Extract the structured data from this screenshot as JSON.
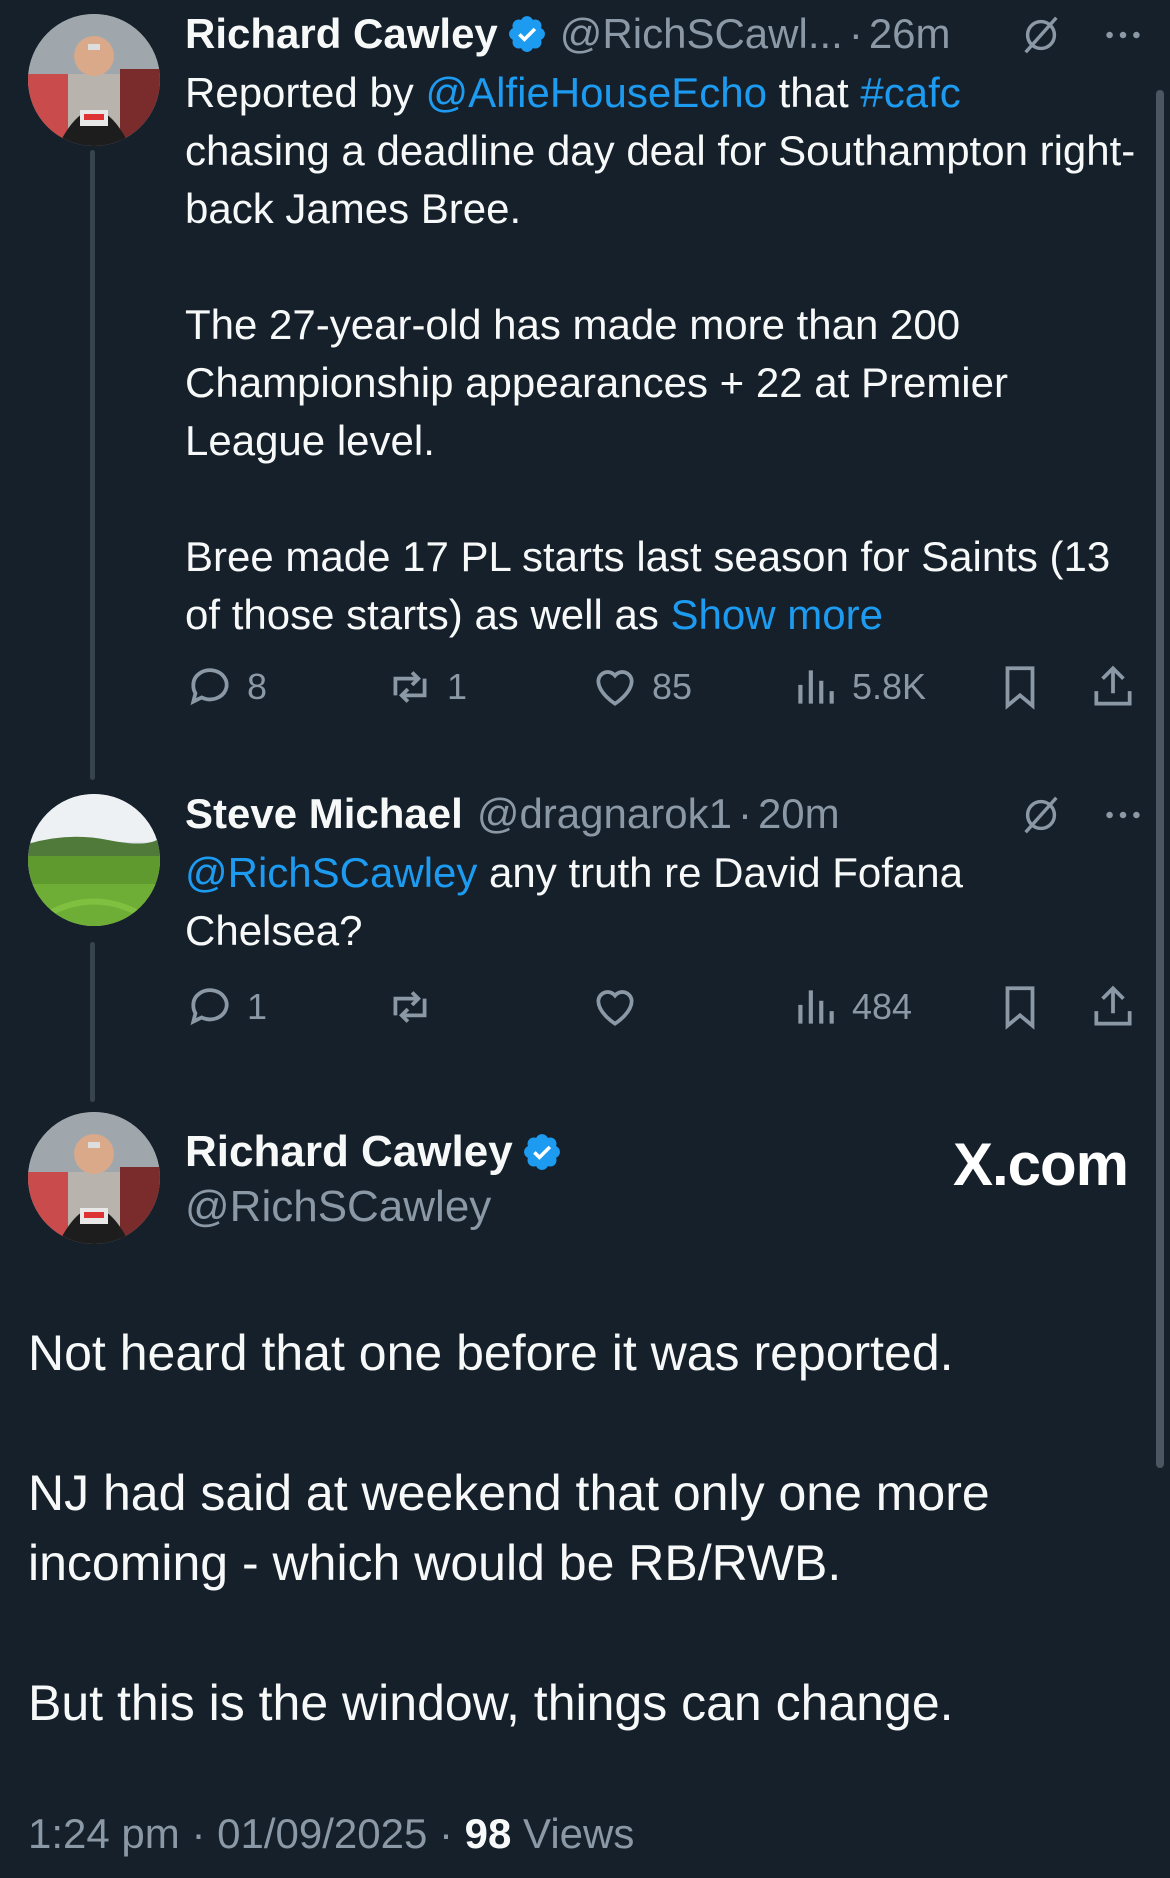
{
  "tweet1": {
    "name": "Richard Cawley",
    "handle": "@RichSCawl...",
    "sep": "·",
    "time": "26m",
    "body_prefix": "Reported by ",
    "mention": "@AlfieHouseEcho",
    "mid": " that ",
    "hashtag": "#cafc",
    "body_rest": "\nchasing a deadline day deal for Southampton right-back James Bree.\n\nThe 27-year-old has made more than 200 Championship appearances + 22 at Premier League level.\n\nBree made 17 PL starts last season for Saints (13 of those starts) as well as ",
    "show_more": "Show more",
    "replies": "8",
    "reposts": "1",
    "likes": "85",
    "views": "5.8K"
  },
  "tweet2": {
    "name": "Steve Michael",
    "handle": "@dragnarok1",
    "sep": "·",
    "time": "20m",
    "mention": "@RichSCawley",
    "body_rest": " any truth re David Fofana Chelsea?",
    "replies": "1",
    "reposts": "",
    "likes": "",
    "views": "484"
  },
  "main": {
    "name": "Richard Cawley",
    "handle": "@RichSCawley",
    "watermark": "X.com",
    "body": "Not heard that one before it was reported.\n\nNJ had said at weekend that only one more incoming - which would be RB/RWB.\n\nBut this is the window, things can change.",
    "time": "1:24 pm",
    "sep": "·",
    "date": "01/09/2025",
    "views_count": "98",
    "views_label": " Views"
  },
  "colors": {
    "background": "#15202b",
    "link": "#1d9bf0",
    "muted": "#8b98a5",
    "verified": "#1d9bf0"
  },
  "icons": [
    "verified-badge-icon",
    "grok-icon",
    "more-icon",
    "reply-icon",
    "repost-icon",
    "like-icon",
    "views-icon",
    "bookmark-icon",
    "share-icon"
  ]
}
